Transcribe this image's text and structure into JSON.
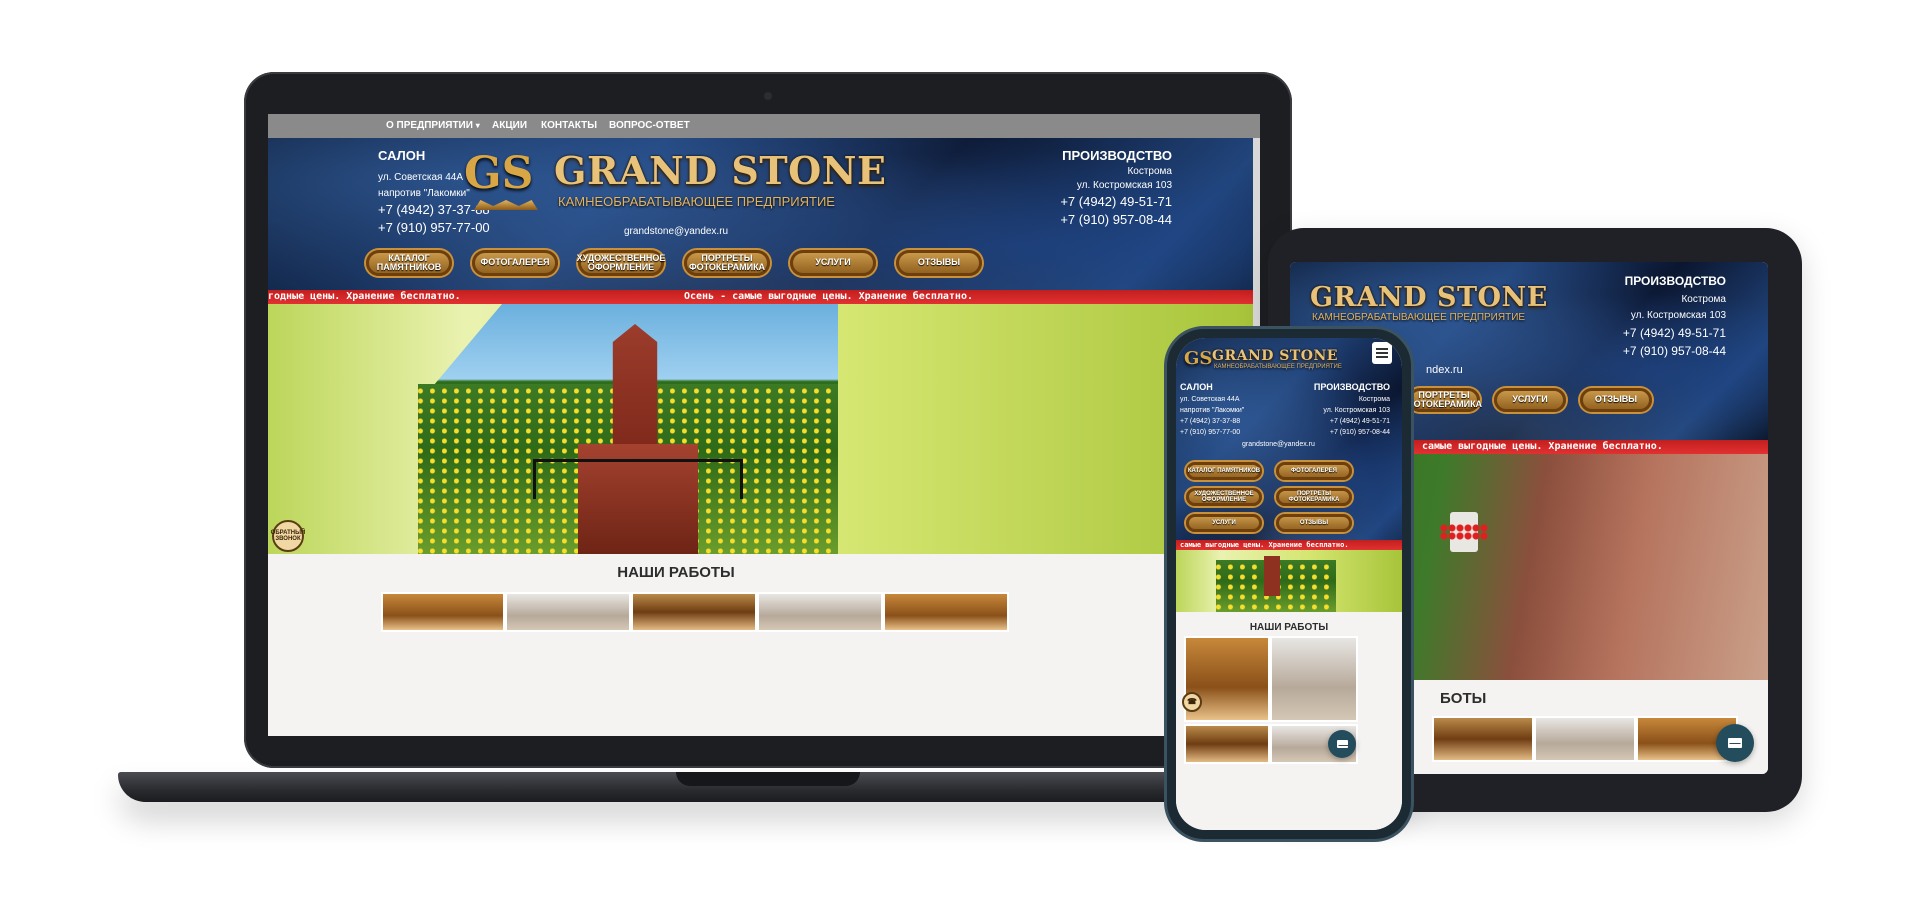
{
  "desktop": {
    "nav": {
      "about": "О ПРЕДПРИЯТИИ",
      "promos": "АКЦИИ",
      "contacts": "КОНТАКТЫ",
      "faq": "ВОПРОС-ОТВЕТ"
    },
    "salon": {
      "title": "САЛОН",
      "street": "ул. Советская 44А",
      "landmark": "напротив \"Лакомки\"",
      "phone1": "+7 (4942) 37-37-88",
      "phone2": "+7 (910) 957-77-00"
    },
    "production": {
      "title": "ПРОИЗВОДСТВО",
      "city": "Кострома",
      "street": "ул. Костромская 103",
      "phone1": "+7 (4942) 49-51-71",
      "phone2": "+7 (910) 957-08-44"
    },
    "logo": {
      "monogram": "GS",
      "name": "GRAND STONE",
      "tagline": "КАМНЕОБРАБАТЫВАЮЩЕЕ ПРЕДПРИЯТИЕ"
    },
    "email": "grandstone@yandex.ru",
    "buttons": {
      "catalog": "КАТАЛОГ ПАМЯТНИКОВ",
      "gallery": "ФОТОГАЛЕРЕЯ",
      "design": "ХУДОЖЕСТВЕННОЕ ОФОРМЛЕНИЕ",
      "portraits": "ПОРТРЕТЫ ФОТОКЕРАМИКА",
      "services": "УСЛУГИ",
      "reviews": "ОТЗЫВЫ"
    },
    "marquee_left": "годные цены. Хранение бесплатно.",
    "marquee_right": "Осень - самые выгодные цены. Хранение бесплатно.",
    "callback": "ОБРАТНЫЙ ЗВОНОК",
    "works_title": "НАШИ РАБОТЫ"
  },
  "tablet": {
    "logo": {
      "name": "GRAND STONE",
      "tagline": "КАМНЕОБРАБАТЫВАЮЩЕЕ ПРЕДПРИЯТИЕ"
    },
    "production": {
      "title": "ПРОИЗВОДСТВО",
      "city": "Кострома",
      "street": "ул. Костромская 103",
      "phone1": "+7 (4942) 49-51-71",
      "phone2": "+7 (910) 957-08-44"
    },
    "email_partial": "ndex.ru",
    "buttons": {
      "portraits": "ПОРТРЕТЫ ФОТОКЕРАМИКА",
      "services": "УСЛУГИ",
      "reviews": "ОТЗЫВЫ"
    },
    "marquee": "самые выгодные цены. Хранение бесплатно.",
    "works_title_partial": "БОТЫ"
  },
  "phone": {
    "logo": {
      "monogram": "GS",
      "name": "GRAND STONE",
      "tagline": "КАМНЕОБРАБАТЫВАЮЩЕЕ ПРЕДПРИЯТИЕ"
    },
    "salon": {
      "title": "САЛОН",
      "street": "ул. Советская 44А",
      "landmark": "напротив \"Лакомки\"",
      "phone1": "+7 (4942) 37-37-88",
      "phone2": "+7 (910) 957-77-00"
    },
    "production": {
      "title": "ПРОИЗВОДСТВО",
      "city": "Кострома",
      "street": "ул. Костромская 103",
      "phone1": "+7 (4942) 49-51-71",
      "phone2": "+7 (910) 957-08-44"
    },
    "email": "grandstone@yandex.ru",
    "buttons": {
      "catalog": "КАТАЛОГ ПАМЯТНИКОВ",
      "gallery": "ФОТОГАЛЕРЕЯ",
      "design": "ХУДОЖЕСТВЕННОЕ ОФОРМЛЕНИЕ",
      "portraits": "ПОРТРЕТЫ ФОТОКЕРАМИКА",
      "services": "УСЛУГИ",
      "reviews": "ОТЗЫВЫ"
    },
    "marquee": "самые выгодные цены. Хранение бесплатно.",
    "works_title": "НАШИ РАБОТЫ"
  },
  "icons": {
    "dropdown": "chevron-down-icon",
    "mail": "mail-icon",
    "menu": "hamburger-menu-icon",
    "callback": "phone-callback-icon"
  },
  "colors": {
    "nav": "#8a8a8a",
    "marquee": "#d62828",
    "gold": "#d9a646",
    "stone": "#1e3e72",
    "mail_fab": "#234d5c"
  }
}
